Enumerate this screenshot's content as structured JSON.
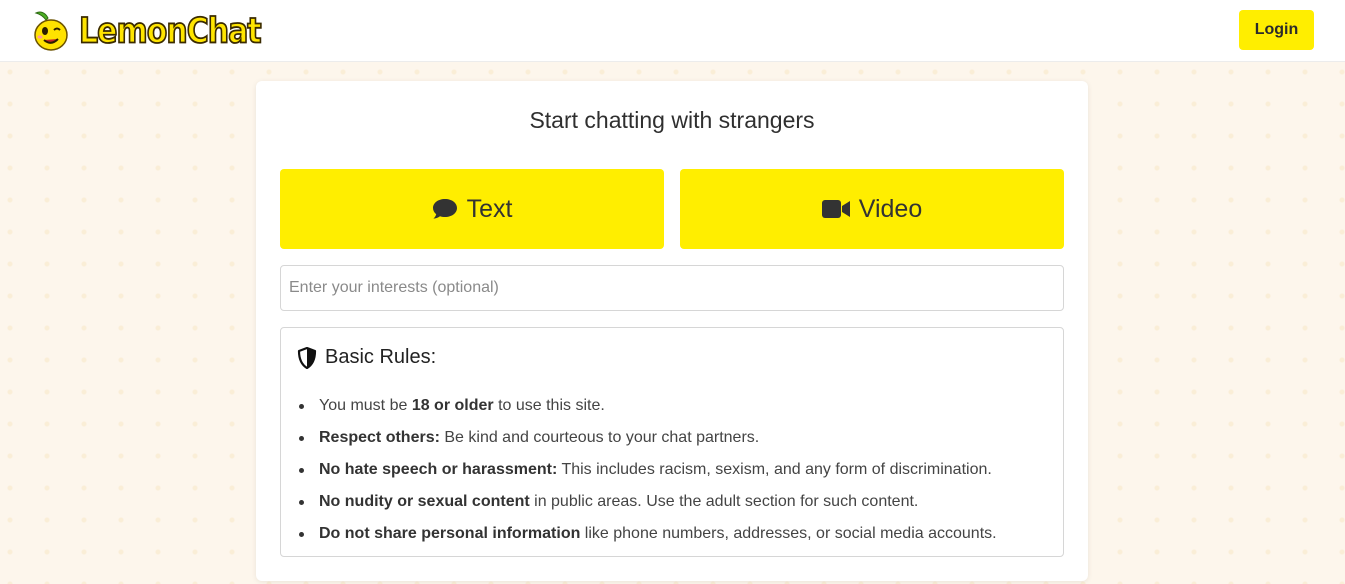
{
  "header": {
    "brand": "LemonChat",
    "login_label": "Login"
  },
  "main": {
    "title": "Start chatting with strangers",
    "text_button_label": "Text",
    "video_button_label": "Video",
    "interests_placeholder": "Enter your interests (optional)",
    "rules": {
      "title": "Basic Rules:",
      "items": [
        {
          "pre": "You must be ",
          "bold": "18 or older",
          "post": " to use this site."
        },
        {
          "pre": "",
          "bold": "Respect others:",
          "post": " Be kind and courteous to your chat partners."
        },
        {
          "pre": "",
          "bold": "No hate speech or harassment:",
          "post": " This includes racism, sexism, and any form of discrimination."
        },
        {
          "pre": "",
          "bold": "No nudity or sexual content",
          "post": " in public areas. Use the adult section for such content."
        },
        {
          "pre": "",
          "bold": "Do not share personal information",
          "post": " like phone numbers, addresses, or social media accounts."
        }
      ]
    }
  },
  "colors": {
    "accent": "#ffee00",
    "background": "#fdf6ec"
  },
  "icons": {
    "logo": "lemon-mascot-icon",
    "text_button": "comment-icon",
    "video_button": "video-camera-icon",
    "rules": "shield-icon"
  }
}
